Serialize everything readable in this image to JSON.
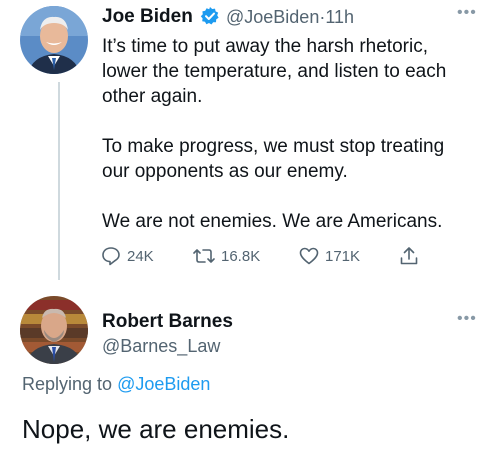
{
  "tweet": {
    "author_name": "Joe Biden",
    "handle": "@JoeBiden",
    "separator": "·",
    "time": "11h",
    "lines": [
      "It’s time to put away the harsh rhetoric,",
      "lower the temperature, and listen to each",
      "other again.",
      "To make progress, we must stop treating",
      "our opponents as our enemy.",
      "We are not enemies. We are Americans."
    ],
    "replies": "24K",
    "retweets": "16.8K",
    "likes": "171K",
    "more_icon": "ellipsis-icon",
    "verified_icon": "verified-badge-icon",
    "accent": "#1d9bf0"
  },
  "reply": {
    "author_name": "Robert Barnes",
    "handle": "@Barnes_Law",
    "replying_label": "Replying to",
    "replying_to": "@JoeBiden",
    "text": "Nope, we are enemies.",
    "more_icon": "ellipsis-icon"
  }
}
